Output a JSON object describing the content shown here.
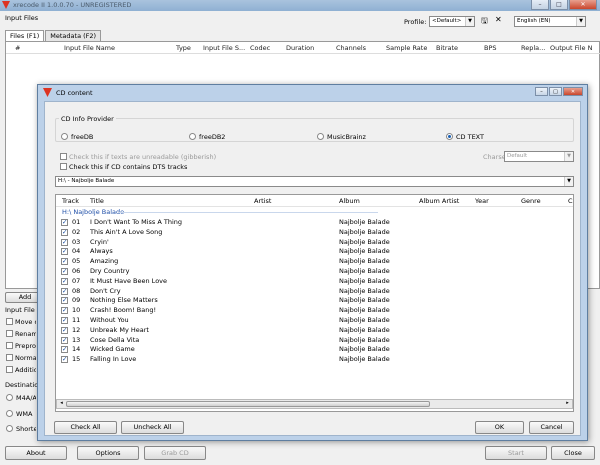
{
  "window": {
    "title": "xrecode II 1.0.0.70 - UNREGISTERED",
    "minimize": "–",
    "maximize": "□",
    "close": "✕"
  },
  "main": {
    "input_files_label": "Input Files",
    "profile_label": "Profile:",
    "profile_value": "<Default>",
    "language_value": "English (EN)",
    "tabs": [
      "Files (F1)",
      "Metadata (F2)"
    ],
    "columns": [
      "#",
      "Input File Name",
      "Type",
      "Input File S...",
      "Codec",
      "Duration",
      "Channels",
      "Sample Rate",
      "Bitrate",
      "BPS",
      "Repla...",
      "Output File N"
    ],
    "add_button": "Add",
    "input_file_settings_label": "Input File S",
    "side_options": [
      "Move o",
      "Renam",
      "Preproc",
      "Normal",
      "Additio"
    ],
    "destination_label": "Destination",
    "destination_radios": [
      "M4A/A",
      "WMA",
      "Shorten"
    ],
    "bottom_buttons": {
      "about": "About",
      "options": "Options",
      "grab_cd": "Grab CD",
      "start": "Start",
      "close": "Close"
    }
  },
  "dialog": {
    "title": "CD content",
    "provider_caption": "CD Info Provider",
    "providers": [
      {
        "label": "freeDB",
        "checked": false
      },
      {
        "label": "freeDB2",
        "checked": false
      },
      {
        "label": "MusicBrainz",
        "checked": false
      },
      {
        "label": "CD TEXT",
        "checked": true
      }
    ],
    "check_gibberish": "Check this if texts are unreadable (gibberish)",
    "check_dts": "Check this if CD contains DTS tracks",
    "charset_label": "Charset",
    "charset_value": "Default",
    "cd_selector": "H:\\ - Najbolje Balade",
    "columns": [
      "Track",
      "Title",
      "Artist",
      "Album",
      "Album Artist",
      "Year",
      "Genre",
      "C"
    ],
    "group_label": "H:\\ Najbolje Balade",
    "tracks": [
      {
        "track": "01",
        "title": "I Don't Want To Miss A Thing",
        "album": "Najbolje Balade"
      },
      {
        "track": "02",
        "title": "This Ain't A Love Song",
        "album": "Najbolje Balade"
      },
      {
        "track": "03",
        "title": "Cryin'",
        "album": "Najbolje Balade"
      },
      {
        "track": "04",
        "title": "Always",
        "album": "Najbolje Balade"
      },
      {
        "track": "05",
        "title": "Amazing",
        "album": "Najbolje Balade"
      },
      {
        "track": "06",
        "title": "Dry Country",
        "album": "Najbolje Balade"
      },
      {
        "track": "07",
        "title": "It Must Have Been Love",
        "album": "Najbolje Balade"
      },
      {
        "track": "08",
        "title": "Don't Cry",
        "album": "Najbolje Balade"
      },
      {
        "track": "09",
        "title": "Nothing Else Matters",
        "album": "Najbolje Balade"
      },
      {
        "track": "10",
        "title": "Crash! Boom! Bang!",
        "album": "Najbolje Balade"
      },
      {
        "track": "11",
        "title": "Without You",
        "album": "Najbolje Balade"
      },
      {
        "track": "12",
        "title": "Unbreak My Heart",
        "album": "Najbolje Balade"
      },
      {
        "track": "13",
        "title": "Cose Della Vita",
        "album": "Najbolje Balade"
      },
      {
        "track": "14",
        "title": "Wicked Game",
        "album": "Najbolje Balade"
      },
      {
        "track": "15",
        "title": "Falling In Love",
        "album": "Najbolje Balade"
      }
    ],
    "buttons": {
      "check_all": "Check All",
      "uncheck_all": "Uncheck All",
      "ok": "OK",
      "cancel": "Cancel"
    }
  }
}
